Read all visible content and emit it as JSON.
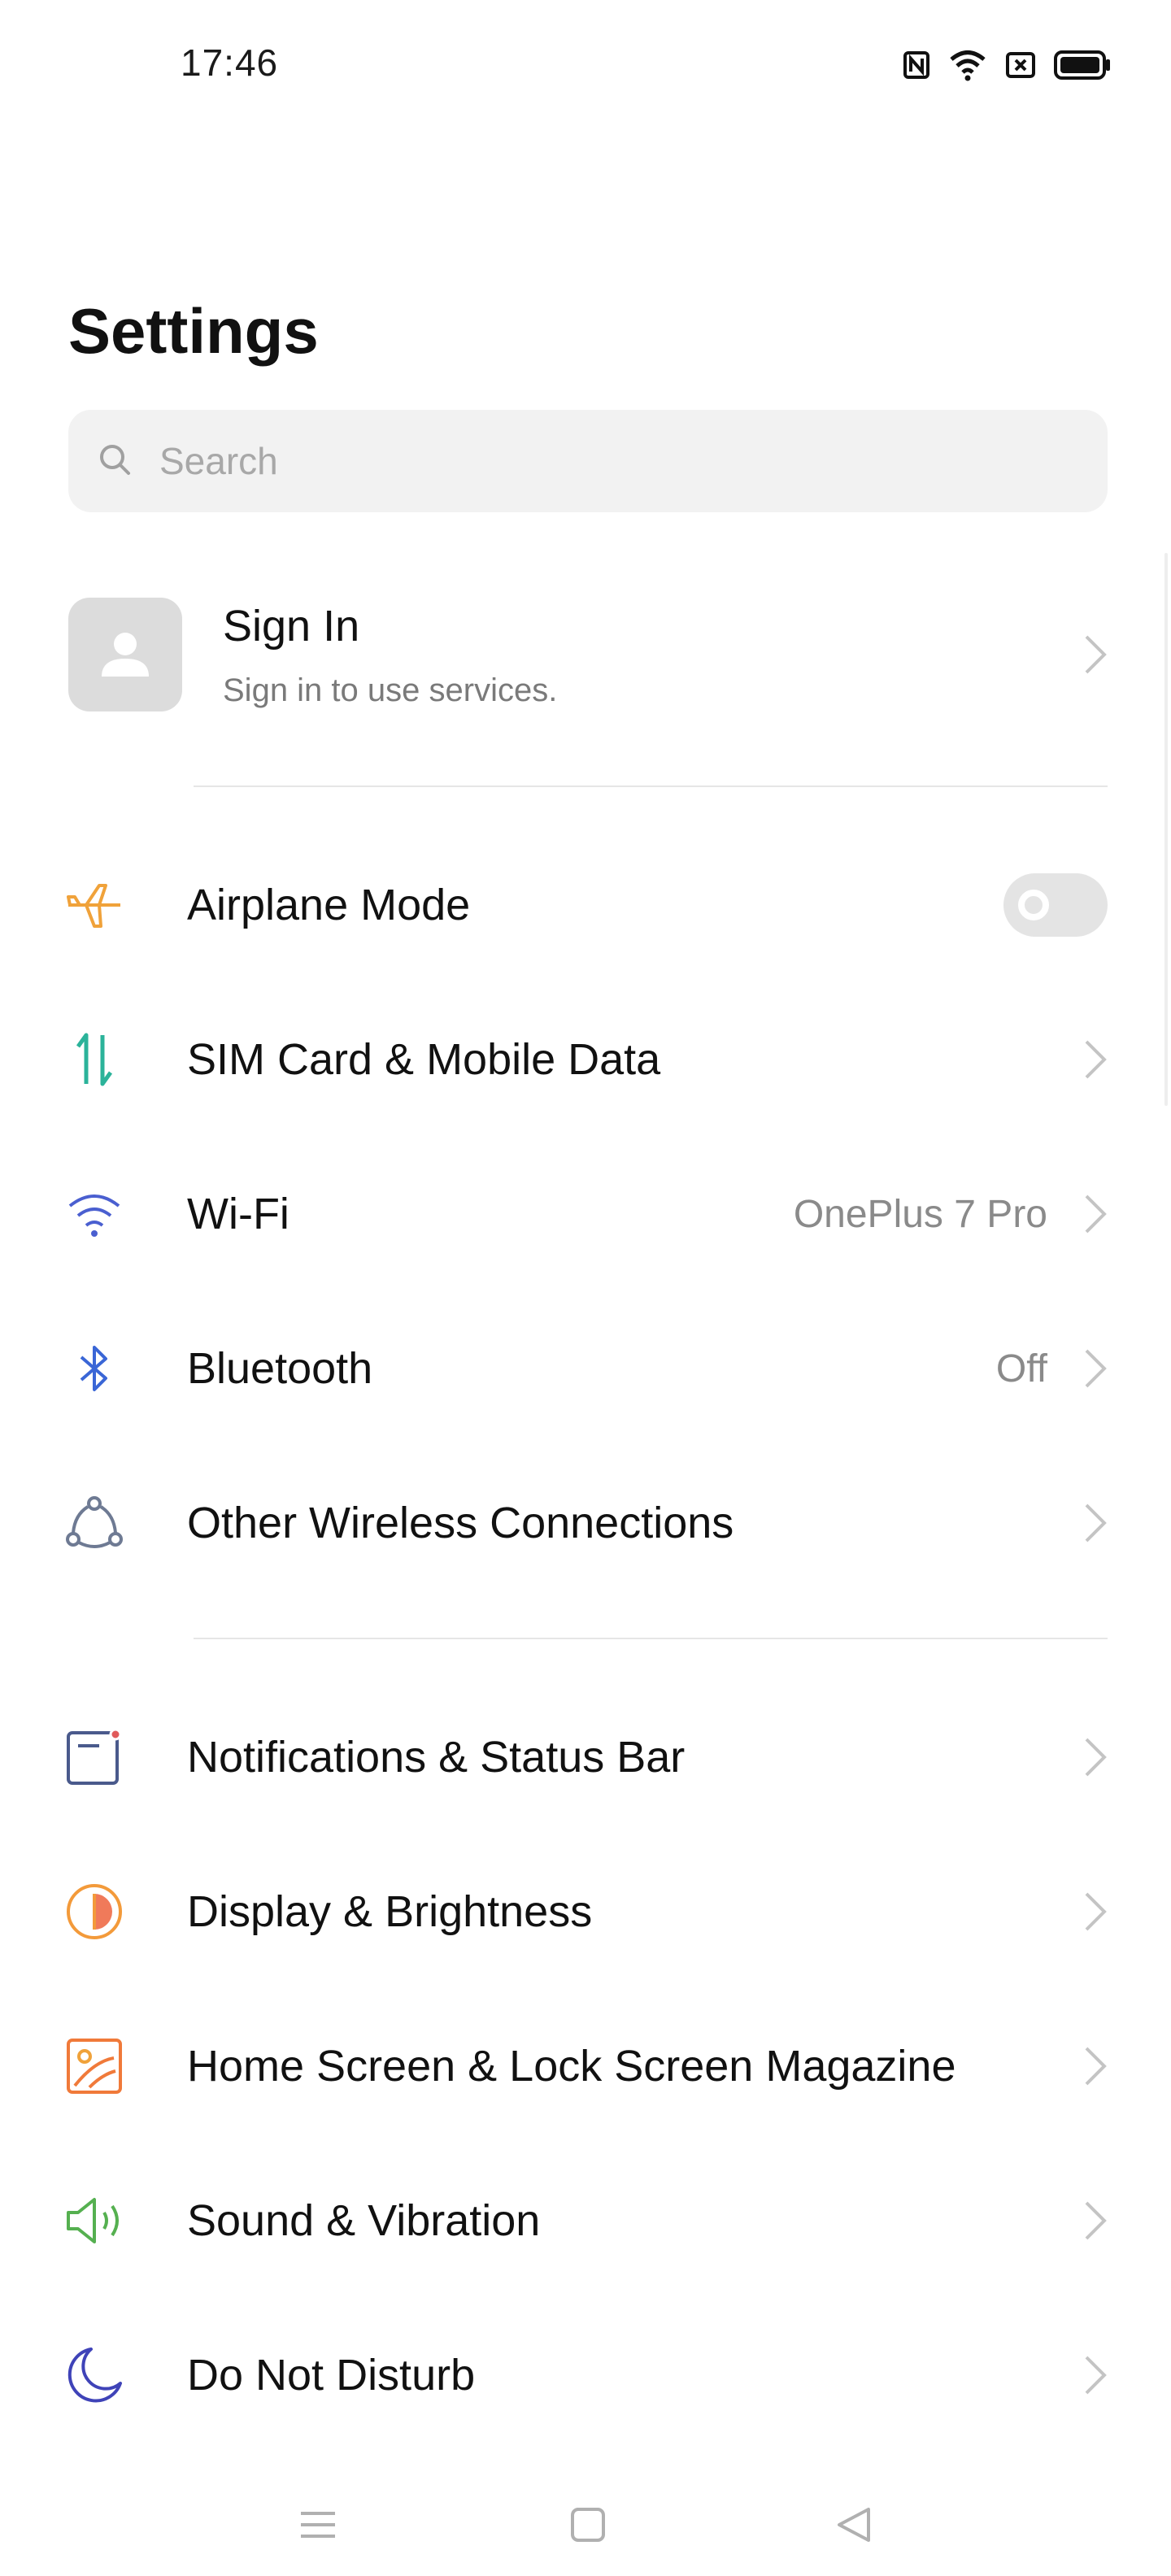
{
  "status_bar": {
    "time": "17:46",
    "icons": [
      "nfc-icon",
      "wifi-icon",
      "sim-blocked-icon",
      "battery-icon"
    ]
  },
  "header": {
    "title": "Settings"
  },
  "search": {
    "placeholder": "Search",
    "value": ""
  },
  "account": {
    "title": "Sign In",
    "subtitle": "Sign in to use services."
  },
  "sections": [
    [
      {
        "id": "airplane",
        "label": "Airplane Mode",
        "icon": "airplane-icon",
        "control": "toggle",
        "toggle_on": false
      },
      {
        "id": "sim",
        "label": "SIM Card & Mobile Data",
        "icon": "sim-data-icon"
      },
      {
        "id": "wifi",
        "label": "Wi-Fi",
        "icon": "wifi-icon",
        "value": "OnePlus 7 Pro"
      },
      {
        "id": "bluetooth",
        "label": "Bluetooth",
        "icon": "bluetooth-icon",
        "value": "Off"
      },
      {
        "id": "wireless",
        "label": "Other Wireless Connections",
        "icon": "connections-icon"
      }
    ],
    [
      {
        "id": "notifications",
        "label": "Notifications & Status Bar",
        "icon": "notification-icon"
      },
      {
        "id": "display",
        "label": "Display & Brightness",
        "icon": "brightness-icon"
      },
      {
        "id": "homescreen",
        "label": "Home Screen & Lock Screen Magazine",
        "icon": "wallpaper-icon"
      },
      {
        "id": "sound",
        "label": "Sound & Vibration",
        "icon": "speaker-icon"
      },
      {
        "id": "dnd",
        "label": "Do Not Disturb",
        "icon": "moon-icon"
      }
    ]
  ],
  "colors": {
    "airplane": "#f0a23a",
    "sim": "#2bb39a",
    "wifi": "#4a5fd0",
    "bluetooth": "#3a66d6",
    "wireless": "#6e7a93",
    "notifications": "#4a5a8c",
    "display": "#f39a3a",
    "homescreen": "#f07a3a",
    "sound": "#55b050",
    "dnd": "#3f43b8"
  },
  "navbar": {
    "buttons": [
      "menu-icon",
      "home-icon",
      "back-icon"
    ]
  }
}
